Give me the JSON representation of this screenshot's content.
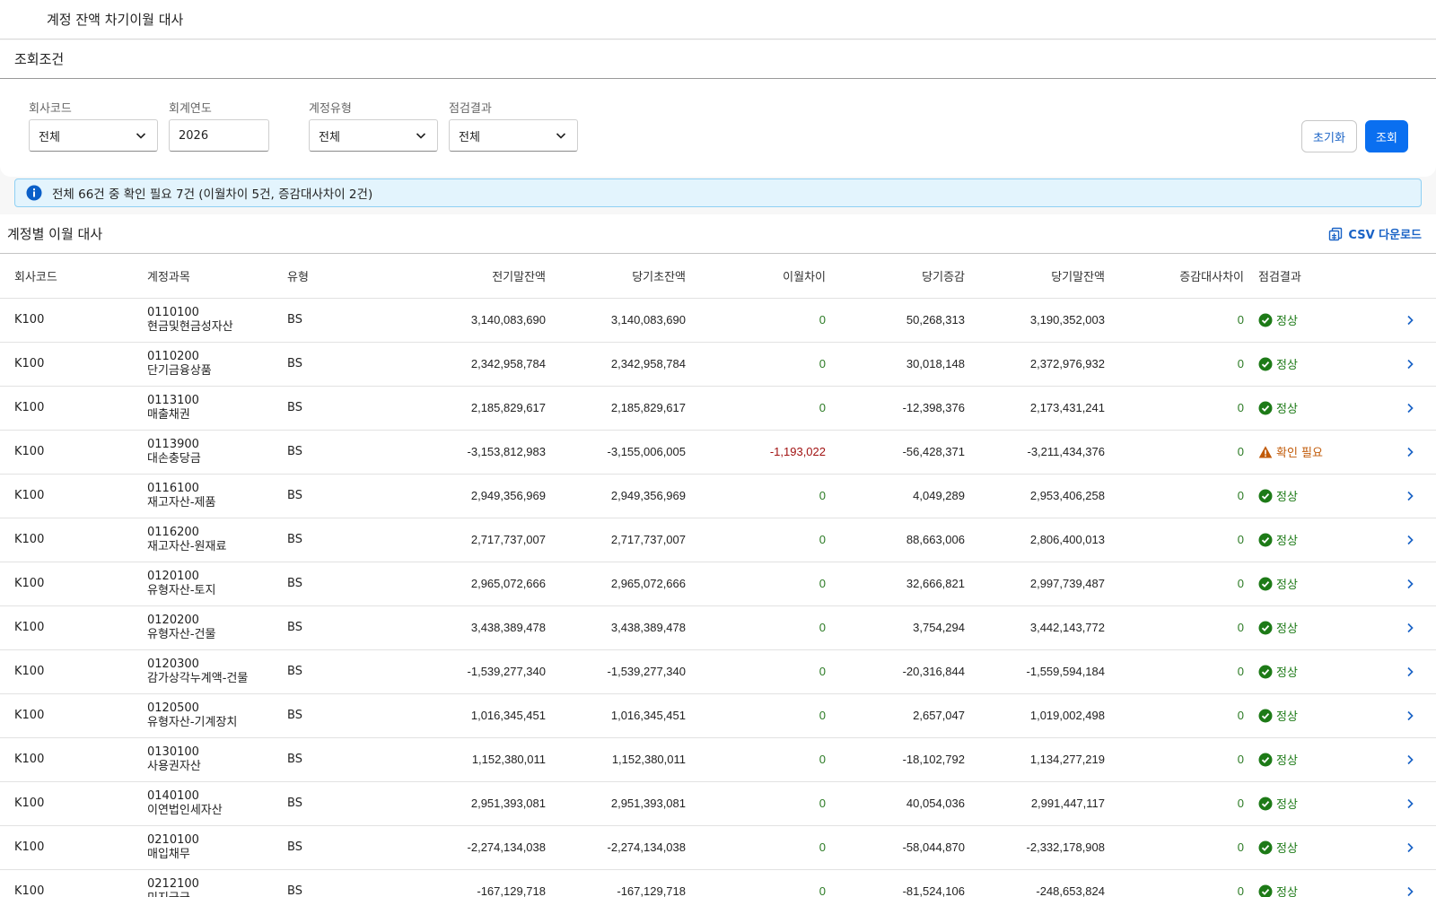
{
  "header": {
    "title": "계정 잔액 차기이월 대사"
  },
  "search": {
    "panel_title": "조회조건",
    "company_code": {
      "label": "회사코드",
      "value": "전체"
    },
    "fiscal_year": {
      "label": "회계연도",
      "value": "2026"
    },
    "account_type": {
      "label": "계정유형",
      "value": "전체"
    },
    "check_result": {
      "label": "점검결과",
      "value": "전체"
    },
    "reset_label": "초기화",
    "search_label": "조회"
  },
  "info": {
    "message": "전체 66건 중 확인 필요 7건 (이월차이 5건, 증감대사차이 2건)"
  },
  "table": {
    "title": "계정별 이월 대사",
    "csv_label": "CSV 다운로드",
    "columns": [
      "회사코드",
      "계정과목",
      "유형",
      "전기말잔액",
      "당기초잔액",
      "이월차이",
      "당기증감",
      "당기말잔액",
      "증감대사차이",
      "점검결과"
    ],
    "rows": [
      {
        "company": "K100",
        "code": "0110100",
        "name": "현금및현금성자산",
        "type": "BS",
        "prev_end": "3,140,083,690",
        "cur_begin": "3,140,083,690",
        "carry_diff": "0",
        "change": "50,268,313",
        "cur_end": "3,190,352,003",
        "recon_diff": "0",
        "status": "정상"
      },
      {
        "company": "K100",
        "code": "0110200",
        "name": "단기금융상품",
        "type": "BS",
        "prev_end": "2,342,958,784",
        "cur_begin": "2,342,958,784",
        "carry_diff": "0",
        "change": "30,018,148",
        "cur_end": "2,372,976,932",
        "recon_diff": "0",
        "status": "정상"
      },
      {
        "company": "K100",
        "code": "0113100",
        "name": "매출채권",
        "type": "BS",
        "prev_end": "2,185,829,617",
        "cur_begin": "2,185,829,617",
        "carry_diff": "0",
        "change": "-12,398,376",
        "cur_end": "2,173,431,241",
        "recon_diff": "0",
        "status": "정상"
      },
      {
        "company": "K100",
        "code": "0113900",
        "name": "대손충당금",
        "type": "BS",
        "prev_end": "-3,153,812,983",
        "cur_begin": "-3,155,006,005",
        "carry_diff": "-1,193,022",
        "change": "-56,428,371",
        "cur_end": "-3,211,434,376",
        "recon_diff": "0",
        "status": "확인 필요"
      },
      {
        "company": "K100",
        "code": "0116100",
        "name": "재고자산-제품",
        "type": "BS",
        "prev_end": "2,949,356,969",
        "cur_begin": "2,949,356,969",
        "carry_diff": "0",
        "change": "4,049,289",
        "cur_end": "2,953,406,258",
        "recon_diff": "0",
        "status": "정상"
      },
      {
        "company": "K100",
        "code": "0116200",
        "name": "재고자산-원재료",
        "type": "BS",
        "prev_end": "2,717,737,007",
        "cur_begin": "2,717,737,007",
        "carry_diff": "0",
        "change": "88,663,006",
        "cur_end": "2,806,400,013",
        "recon_diff": "0",
        "status": "정상"
      },
      {
        "company": "K100",
        "code": "0120100",
        "name": "유형자산-토지",
        "type": "BS",
        "prev_end": "2,965,072,666",
        "cur_begin": "2,965,072,666",
        "carry_diff": "0",
        "change": "32,666,821",
        "cur_end": "2,997,739,487",
        "recon_diff": "0",
        "status": "정상"
      },
      {
        "company": "K100",
        "code": "0120200",
        "name": "유형자산-건물",
        "type": "BS",
        "prev_end": "3,438,389,478",
        "cur_begin": "3,438,389,478",
        "carry_diff": "0",
        "change": "3,754,294",
        "cur_end": "3,442,143,772",
        "recon_diff": "0",
        "status": "정상"
      },
      {
        "company": "K100",
        "code": "0120300",
        "name": "감가상각누계액-건물",
        "type": "BS",
        "prev_end": "-1,539,277,340",
        "cur_begin": "-1,539,277,340",
        "carry_diff": "0",
        "change": "-20,316,844",
        "cur_end": "-1,559,594,184",
        "recon_diff": "0",
        "status": "정상"
      },
      {
        "company": "K100",
        "code": "0120500",
        "name": "유형자산-기계장치",
        "type": "BS",
        "prev_end": "1,016,345,451",
        "cur_begin": "1,016,345,451",
        "carry_diff": "0",
        "change": "2,657,047",
        "cur_end": "1,019,002,498",
        "recon_diff": "0",
        "status": "정상"
      },
      {
        "company": "K100",
        "code": "0130100",
        "name": "사용권자산",
        "type": "BS",
        "prev_end": "1,152,380,011",
        "cur_begin": "1,152,380,011",
        "carry_diff": "0",
        "change": "-18,102,792",
        "cur_end": "1,134,277,219",
        "recon_diff": "0",
        "status": "정상"
      },
      {
        "company": "K100",
        "code": "0140100",
        "name": "이연법인세자산",
        "type": "BS",
        "prev_end": "2,951,393,081",
        "cur_begin": "2,951,393,081",
        "carry_diff": "0",
        "change": "40,054,036",
        "cur_end": "2,991,447,117",
        "recon_diff": "0",
        "status": "정상"
      },
      {
        "company": "K100",
        "code": "0210100",
        "name": "매입채무",
        "type": "BS",
        "prev_end": "-2,274,134,038",
        "cur_begin": "-2,274,134,038",
        "carry_diff": "0",
        "change": "-58,044,870",
        "cur_end": "-2,332,178,908",
        "recon_diff": "0",
        "status": "정상"
      },
      {
        "company": "K100",
        "code": "0212100",
        "name": "미지급금",
        "type": "BS",
        "prev_end": "-167,129,718",
        "cur_begin": "-167,129,718",
        "carry_diff": "0",
        "change": "-81,524,106",
        "cur_end": "-248,653,824",
        "recon_diff": "0",
        "status": "정상"
      }
    ]
  },
  "colors": {
    "accent": "#0a6ff0",
    "ok": "#1d7a17",
    "warn": "#c15a08",
    "diff_negative": "#a11212",
    "info_bg": "#e3f4fd"
  },
  "icons": {
    "info": "info-circle-icon",
    "ok": "check-circle-icon",
    "warn": "warning-triangle-icon",
    "row_action": "chevron-right-icon",
    "csv": "csv-download-icon"
  }
}
